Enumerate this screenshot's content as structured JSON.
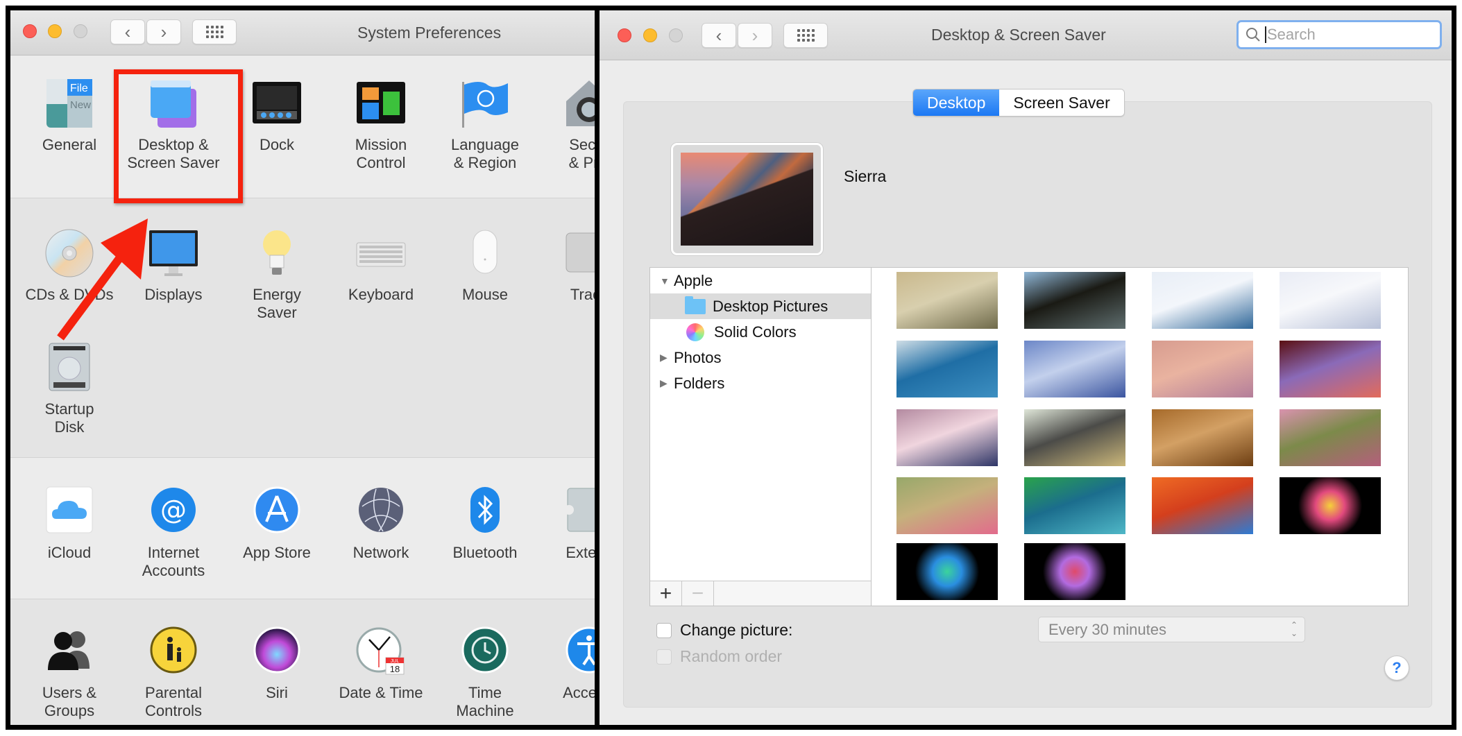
{
  "left_window": {
    "title": "System Preferences",
    "nav": {
      "back_glyph": "‹",
      "forward_glyph": "›",
      "show_all_icon": "grid-icon"
    },
    "sections": [
      {
        "items": [
          {
            "label": "General",
            "icon": "general-icon"
          },
          {
            "label": "Desktop &\nScreen Saver",
            "icon": "desktop-screensaver-icon",
            "highlighted": true
          },
          {
            "label": "Dock",
            "icon": "dock-icon"
          },
          {
            "label": "Mission\nControl",
            "icon": "mission-control-icon"
          },
          {
            "label": "Language\n& Region",
            "icon": "language-region-icon"
          },
          {
            "label": "Secur\n& Priv",
            "icon": "security-privacy-icon"
          }
        ]
      },
      {
        "items": [
          {
            "label": "CDs & DVDs",
            "icon": "cd-dvd-icon"
          },
          {
            "label": "Displays",
            "icon": "displays-icon"
          },
          {
            "label": "Energy\nSaver",
            "icon": "energy-saver-icon"
          },
          {
            "label": "Keyboard",
            "icon": "keyboard-icon"
          },
          {
            "label": "Mouse",
            "icon": "mouse-icon"
          },
          {
            "label": "Track",
            "icon": "trackpad-icon"
          },
          {
            "label": "Startup\nDisk",
            "icon": "startup-disk-icon"
          }
        ]
      },
      {
        "items": [
          {
            "label": "iCloud",
            "icon": "icloud-icon"
          },
          {
            "label": "Internet\nAccounts",
            "icon": "internet-accounts-icon"
          },
          {
            "label": "App Store",
            "icon": "app-store-icon"
          },
          {
            "label": "Network",
            "icon": "network-icon"
          },
          {
            "label": "Bluetooth",
            "icon": "bluetooth-icon"
          },
          {
            "label": "Extens",
            "icon": "extensions-icon"
          }
        ]
      },
      {
        "items": [
          {
            "label": "Users &\nGroups",
            "icon": "users-groups-icon"
          },
          {
            "label": "Parental\nControls",
            "icon": "parental-controls-icon"
          },
          {
            "label": "Siri",
            "icon": "siri-icon"
          },
          {
            "label": "Date & Time",
            "icon": "date-time-icon"
          },
          {
            "label": "Time\nMachine",
            "icon": "time-machine-icon"
          },
          {
            "label": "Accessi",
            "icon": "accessibility-icon"
          }
        ]
      }
    ],
    "date_time_icon": {
      "month": "JUL",
      "day": "18"
    },
    "annotation": {
      "highlight_color": "#f5220e",
      "arrow_color": "#f5220e"
    }
  },
  "right_window": {
    "title": "Desktop & Screen Saver",
    "search": {
      "placeholder": "Search",
      "value": ""
    },
    "tabs": [
      {
        "label": "Desktop",
        "selected": true
      },
      {
        "label": "Screen Saver",
        "selected": false
      }
    ],
    "current_wallpaper": {
      "name": "Sierra"
    },
    "source_list": [
      {
        "label": "Apple",
        "level": 0,
        "expanded": true,
        "disclosure": "▼"
      },
      {
        "label": "Desktop Pictures",
        "level": 1,
        "icon": "folder-icon",
        "selected": true
      },
      {
        "label": "Solid Colors",
        "level": 1,
        "icon": "color-wheel-icon"
      },
      {
        "label": "Photos",
        "level": 0,
        "expanded": false,
        "disclosure": "▶"
      },
      {
        "label": "Folders",
        "level": 0,
        "expanded": false,
        "disclosure": "▶"
      }
    ],
    "list_buttons": {
      "add": "+",
      "remove": "−"
    },
    "thumbnails": [
      {
        "name": "foggy-forest",
        "colors": [
          "#c9b88c",
          "#6f6a4a",
          "#d8cfae"
        ]
      },
      {
        "name": "misty-mountains",
        "colors": [
          "#8fb6d6",
          "#5e6d6e",
          "#1a1a14"
        ]
      },
      {
        "name": "ice-floe",
        "colors": [
          "#e8eef6",
          "#2f6799",
          "#f3f6fb"
        ]
      },
      {
        "name": "clouds",
        "colors": [
          "#e9ecf5",
          "#b8c1d8",
          "#f7f8fb"
        ]
      },
      {
        "name": "blue-pond-trees",
        "colors": [
          "#cfdde6",
          "#3d8fc1",
          "#1f6ea5"
        ]
      },
      {
        "name": "blue-ice-waves",
        "colors": [
          "#6b86c7",
          "#3b55a0",
          "#c3d0ec"
        ]
      },
      {
        "name": "pink-clouds",
        "colors": [
          "#d79c8f",
          "#b47e9a",
          "#e9b3a0"
        ]
      },
      {
        "name": "red-canyon",
        "colors": [
          "#5a0f12",
          "#e26b5b",
          "#8a6ab8"
        ]
      },
      {
        "name": "lake-reflection",
        "colors": [
          "#b38aa0",
          "#2e3566",
          "#f0d5de"
        ]
      },
      {
        "name": "elephant",
        "colors": [
          "#dfe6d8",
          "#cbb77a",
          "#4b4b48"
        ]
      },
      {
        "name": "lion",
        "colors": [
          "#a66a2a",
          "#6d3e12",
          "#d3a064"
        ]
      },
      {
        "name": "pink-grass",
        "colors": [
          "#d993ae",
          "#b45f7c",
          "#7c8a4a"
        ]
      },
      {
        "name": "poppies",
        "colors": [
          "#97a86a",
          "#e26b8c",
          "#c5b07c"
        ]
      },
      {
        "name": "green-marble",
        "colors": [
          "#2aa34b",
          "#4fb7c7",
          "#1b6d8d"
        ]
      },
      {
        "name": "orange-feathers",
        "colors": [
          "#ef6b24",
          "#2e7bd4",
          "#d43f1d"
        ]
      },
      {
        "name": "color-burst-red",
        "colors": [
          "#000000",
          "#e24a7e",
          "#f5d03a"
        ]
      },
      {
        "name": "color-burst-blue",
        "colors": [
          "#000000",
          "#2a8ee0",
          "#3bd39b"
        ]
      },
      {
        "name": "color-burst-purple",
        "colors": [
          "#000000",
          "#b26be0",
          "#e04a6a"
        ]
      }
    ],
    "change_picture": {
      "label": "Change picture:",
      "checked": false,
      "interval": "Every 30 minutes"
    },
    "random_order": {
      "label": "Random order",
      "checked": false,
      "enabled": false
    },
    "help_label": "?",
    "accent_color": "#1c78f3"
  }
}
